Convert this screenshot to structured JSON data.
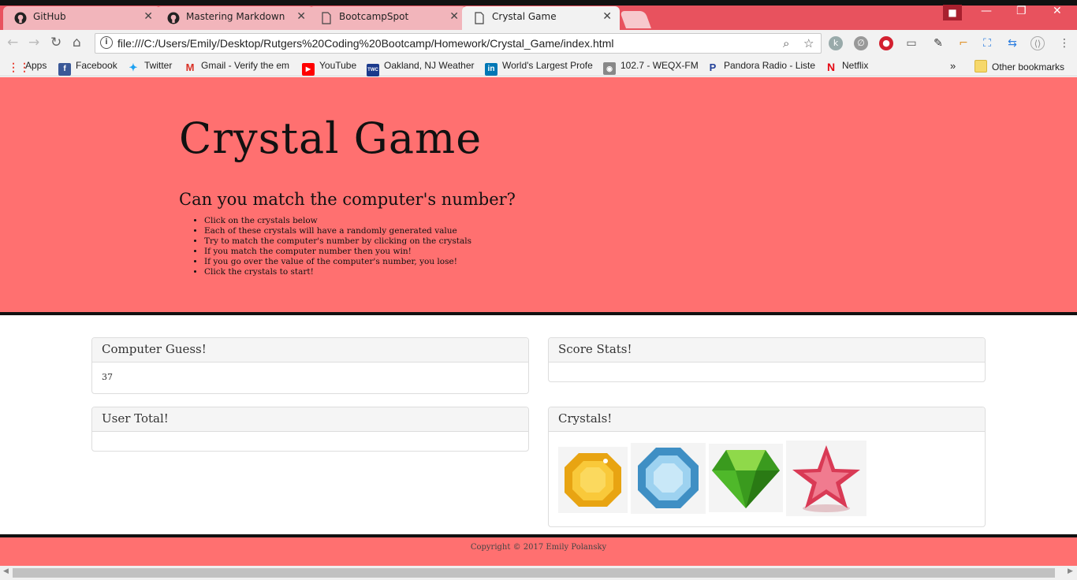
{
  "browser": {
    "tabs": [
      {
        "title": "GitHub",
        "icon": "github-icon",
        "active": false
      },
      {
        "title": "Mastering Markdown · G",
        "icon": "github-icon",
        "active": false
      },
      {
        "title": "BootcampSpot",
        "icon": "document-icon",
        "active": false
      },
      {
        "title": "Crystal Game",
        "icon": "document-icon",
        "active": true
      }
    ],
    "url": "file:///C:/Users/Emily/Desktop/Rutgers%20Coding%20Bootcamp/Homework/Crystal_Game/index.html",
    "bookmarks": [
      {
        "label": "Apps",
        "icon": "apps-grid-icon",
        "color": "#e94235"
      },
      {
        "label": "Facebook",
        "icon": "facebook-icon",
        "color": "#3b5998"
      },
      {
        "label": "Twitter",
        "icon": "twitter-icon",
        "color": "#1da1f2"
      },
      {
        "label": "Gmail - Verify the em",
        "icon": "gmail-icon",
        "color": "#d93025"
      },
      {
        "label": "YouTube",
        "icon": "youtube-icon",
        "color": "#ff0000"
      },
      {
        "label": "Oakland, NJ Weather",
        "icon": "weather-channel-icon",
        "color": "#1b3a8c"
      },
      {
        "label": "World's Largest Profe",
        "icon": "linkedin-icon",
        "color": "#0077b5"
      },
      {
        "label": "102.7 - WEQX-FM",
        "icon": "radio-icon",
        "color": "#666666"
      },
      {
        "label": "Pandora Radio - Liste",
        "icon": "pandora-icon",
        "color": "#224099"
      },
      {
        "label": "Netflix",
        "icon": "netflix-icon",
        "color": "#e50914"
      }
    ],
    "more_bookmarks": "»",
    "other_bookmarks": "Other bookmarks"
  },
  "page": {
    "title": "Crystal Game",
    "subtitle": "Can you match the computer's number?",
    "instructions": [
      "Click on the crystals below",
      "Each of these crystals will have a randomly generated value",
      "Try to match the computer's number by clicking on the crystals",
      "If you match the computer number then you win!",
      "If you go over the value of the computer's number, you lose!",
      "Click the crystals to start!"
    ],
    "panels": {
      "computer_guess": {
        "heading": "Computer Guess!",
        "value": "37"
      },
      "score_stats": {
        "heading": "Score Stats!"
      },
      "user_total": {
        "heading": "User Total!"
      },
      "crystals": {
        "heading": "Crystals!",
        "items": [
          "yellow-crystal",
          "blue-crystal",
          "green-crystal",
          "red-star-crystal"
        ]
      }
    },
    "footer": "Copyright © 2017 Emily Polansky"
  },
  "colors": {
    "jumbotron": "#ff7070",
    "tabstrip": "#e8525e"
  }
}
